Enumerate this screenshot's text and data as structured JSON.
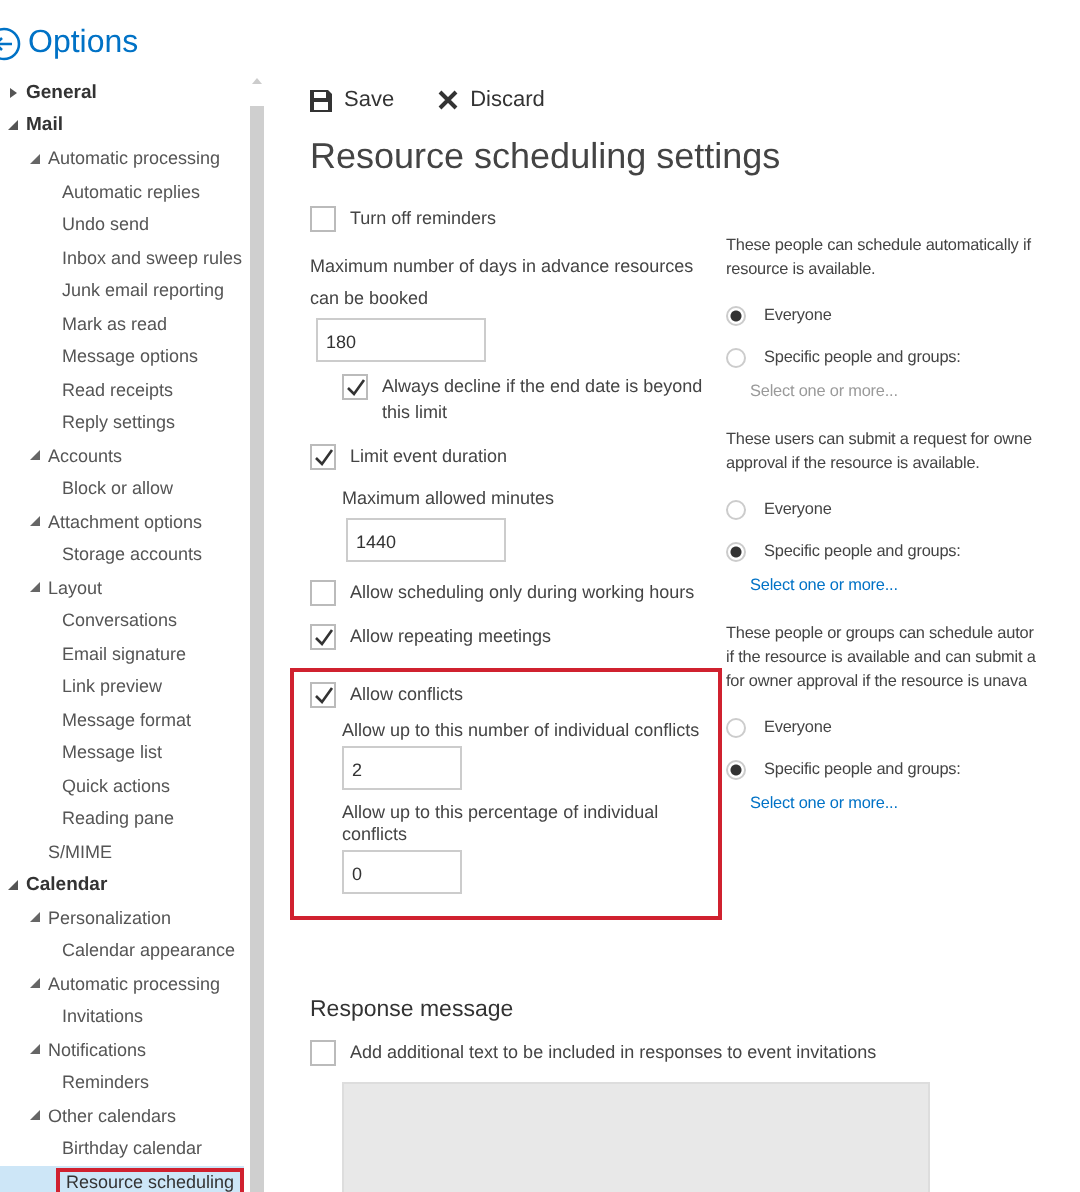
{
  "header": {
    "title": "Options"
  },
  "sidebar": {
    "items": [
      {
        "label": "General",
        "expanded": false,
        "selected": false
      },
      {
        "label": "Mail",
        "expanded": true,
        "selected": false,
        "children": [
          {
            "label": "Automatic processing",
            "expanded": true,
            "selected": false,
            "children": [
              {
                "label": "Automatic replies",
                "selected": false
              },
              {
                "label": "Undo send",
                "selected": false
              },
              {
                "label": "Inbox and sweep rules",
                "selected": false
              },
              {
                "label": "Junk email reporting",
                "selected": false
              },
              {
                "label": "Mark as read",
                "selected": false
              },
              {
                "label": "Message options",
                "selected": false
              },
              {
                "label": "Read receipts",
                "selected": false
              },
              {
                "label": "Reply settings",
                "selected": false
              }
            ]
          },
          {
            "label": "Accounts",
            "expanded": true,
            "selected": false,
            "children": [
              {
                "label": "Block or allow",
                "selected": false
              }
            ]
          },
          {
            "label": "Attachment options",
            "expanded": true,
            "selected": false,
            "children": [
              {
                "label": "Storage accounts",
                "selected": false
              }
            ]
          },
          {
            "label": "Layout",
            "expanded": true,
            "selected": false,
            "children": [
              {
                "label": "Conversations",
                "selected": false
              },
              {
                "label": "Email signature",
                "selected": false
              },
              {
                "label": "Link preview",
                "selected": false
              },
              {
                "label": "Message format",
                "selected": false
              },
              {
                "label": "Message list",
                "selected": false
              },
              {
                "label": "Quick actions",
                "selected": false
              },
              {
                "label": "Reading pane",
                "selected": false
              }
            ]
          },
          {
            "label": "S/MIME",
            "selected": false
          }
        ]
      },
      {
        "label": "Calendar",
        "expanded": true,
        "selected": false,
        "children": [
          {
            "label": "Personalization",
            "expanded": true,
            "selected": false,
            "children": [
              {
                "label": "Calendar appearance",
                "selected": false
              }
            ]
          },
          {
            "label": "Automatic processing",
            "expanded": true,
            "selected": false,
            "children": [
              {
                "label": "Invitations",
                "selected": false
              }
            ]
          },
          {
            "label": "Notifications",
            "expanded": true,
            "selected": false,
            "children": [
              {
                "label": "Reminders",
                "selected": false
              }
            ]
          },
          {
            "label": "Other calendars",
            "expanded": true,
            "selected": false,
            "children": [
              {
                "label": "Birthday calendar",
                "selected": false
              },
              {
                "label": "Resource scheduling",
                "selected": true,
                "highlighted": true
              }
            ]
          }
        ]
      }
    ]
  },
  "toolbar": [
    {
      "kind": "save",
      "label": "Save"
    },
    {
      "kind": "discard",
      "label": "Discard"
    }
  ],
  "title": "Resource scheduling settings",
  "settings": [
    {
      "kind": "checkbox",
      "label": "Turn off reminders",
      "checked": false
    },
    {
      "kind": "inline-field",
      "label": "Maximum number of days in advance resources can be booked",
      "value": "180",
      "children": [
        {
          "kind": "checkbox",
          "label": "Always decline if the end date is beyond this limit",
          "checked": true
        }
      ]
    },
    {
      "kind": "checkbox",
      "label": "Limit event duration",
      "checked": true,
      "children": [
        {
          "kind": "inline-field",
          "label": "Maximum allowed minutes",
          "value": "1440"
        }
      ]
    },
    {
      "kind": "checkbox",
      "label": "Allow scheduling only during working hours",
      "checked": false
    },
    {
      "kind": "checkbox",
      "label": "Allow repeating meetings",
      "checked": true
    },
    {
      "kind": "checkbox",
      "label": "Allow conflicts",
      "checked": true,
      "highlighted": true,
      "children": [
        {
          "kind": "stacked-field",
          "label": "Allow up to this number of individual conflicts",
          "value": "2"
        },
        {
          "kind": "stacked-field",
          "label": "Allow up to this percentage of individual conflicts",
          "value": "0"
        }
      ]
    }
  ],
  "permissions": [
    {
      "lines": [
        "These people can schedule automatically if",
        "resource is available."
      ],
      "options": [
        {
          "label": "Everyone",
          "selected": true
        },
        {
          "label": "Specific people and groups:",
          "selected": false
        }
      ],
      "link": {
        "text": "Select one or more...",
        "disabled": true
      }
    },
    {
      "lines": [
        "These users can submit a request for owne",
        "approval if the resource is available."
      ],
      "options": [
        {
          "label": "Everyone",
          "selected": false
        },
        {
          "label": "Specific people and groups:",
          "selected": true
        }
      ],
      "link": {
        "text": "Select one or more...",
        "disabled": false
      }
    },
    {
      "lines": [
        "These people or groups can schedule autor",
        "if the resource is available and can submit a",
        "for owner approval if the resource is unava"
      ],
      "options": [
        {
          "label": "Everyone",
          "selected": false
        },
        {
          "label": "Specific people and groups:",
          "selected": true
        }
      ],
      "link": {
        "text": "Select one or more...",
        "disabled": false
      }
    }
  ],
  "response": {
    "title": "Response message",
    "checkbox": {
      "label": "Add additional text to be included in responses to event invitations",
      "checked": false
    },
    "textarea": {
      "disabled": true
    }
  }
}
